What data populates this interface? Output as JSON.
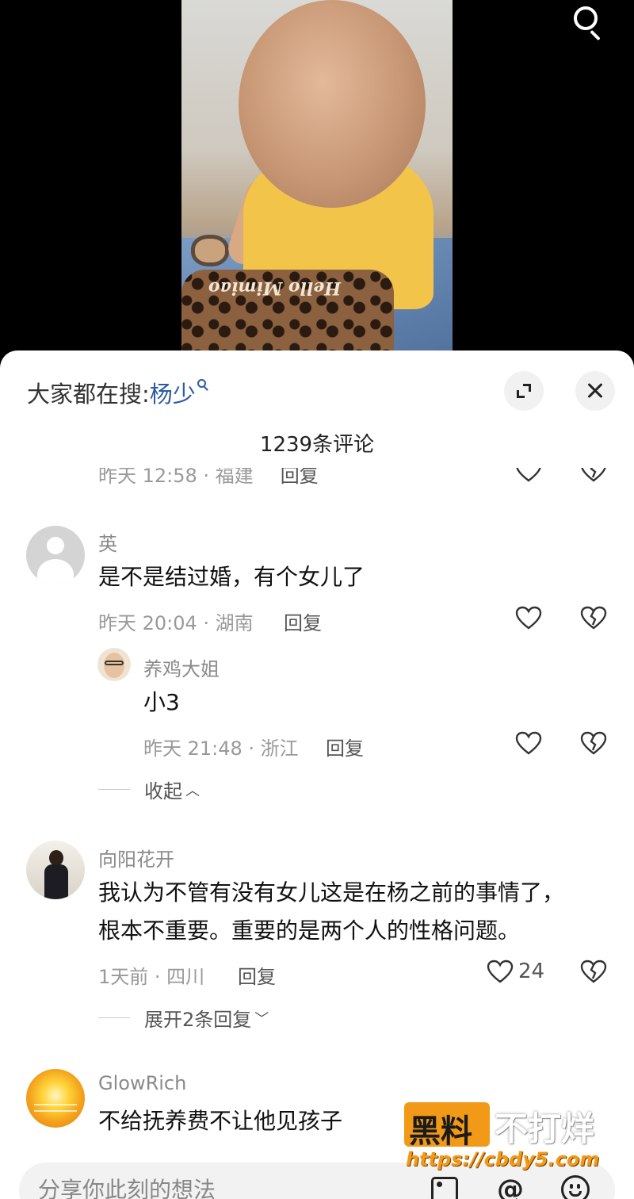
{
  "video": {
    "bag_text": "Hello Mimiao"
  },
  "header": {
    "hot_search_prefix": "大家都在搜:",
    "hot_search_keyword": "杨少",
    "comment_count": "1239条评论"
  },
  "partial_top": {
    "meta": "昨天 12:58 · 福建",
    "reply": "回复"
  },
  "comments": [
    {
      "username": "英",
      "content": "是不是结过婚，有个女儿了",
      "meta": "昨天 20:04 · 湖南",
      "reply": "回复",
      "replies": [
        {
          "username": "养鸡大姐",
          "content": "小3",
          "meta": "昨天 21:48 · 浙江",
          "reply": "回复"
        }
      ],
      "toggle": "收起"
    },
    {
      "username": "向阳花开",
      "content_line1": "我认为不管有没有女儿这是在杨之前的事情了，",
      "content_line2": "根本不重要。重要的是两个人的性格问题。",
      "meta": "1天前 · 四川",
      "reply": "回复",
      "likes": "24",
      "toggle": "展开2条回复"
    },
    {
      "username": "GlowRich",
      "content": "不给抚养费不让他见孩子"
    }
  ],
  "watermark": {
    "main": "黑料",
    "side": "不打烊",
    "url": "https://cbdy5.com"
  },
  "composer": {
    "placeholder": "分享你此刻的想法"
  },
  "icons": {
    "search": "search-icon",
    "expand": "expand-icon",
    "close": "close-icon",
    "like": "heart-icon",
    "dislike": "broken-heart-icon",
    "image": "image-icon",
    "mention": "at-icon",
    "emoji": "emoji-icon"
  }
}
